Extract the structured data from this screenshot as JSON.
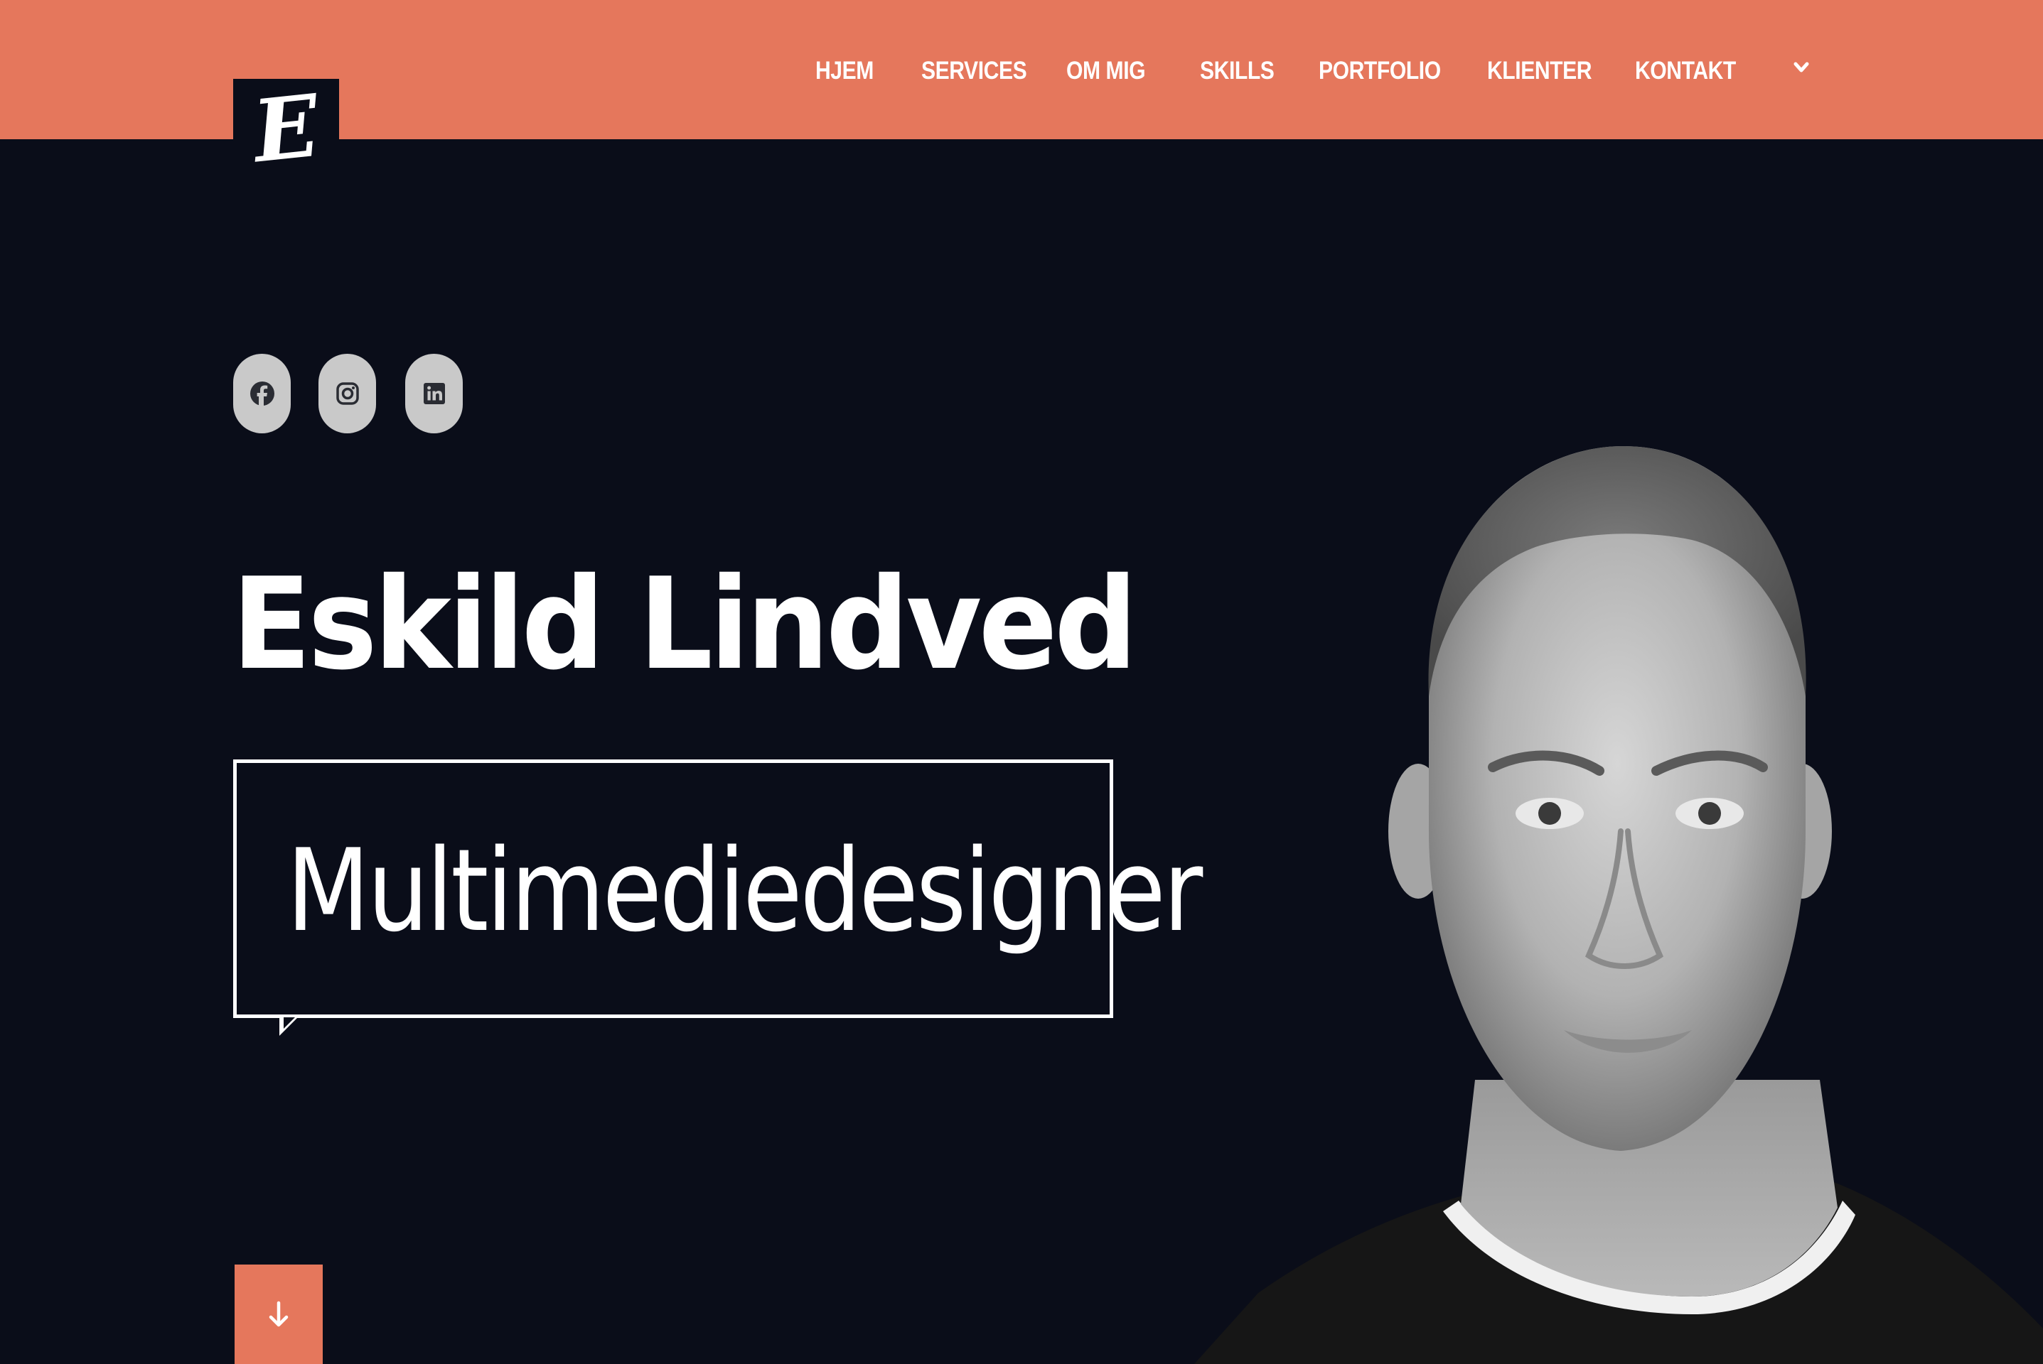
{
  "header": {
    "background_color": "#e5775c",
    "logo_letter": "E",
    "nav": {
      "items": [
        {
          "label": "HJEM"
        },
        {
          "label": "SERVICES"
        },
        {
          "label": "OM MIG"
        },
        {
          "label": "SKILLS"
        },
        {
          "label": "PORTFOLIO"
        },
        {
          "label": "KLIENTER"
        },
        {
          "label": "KONTAKT"
        }
      ],
      "dropdown_icon": "chevron-down-icon"
    }
  },
  "social": {
    "icons": [
      "facebook-icon",
      "instagram-icon",
      "linkedin-icon"
    ],
    "button_color": "#c9c9c9"
  },
  "hero": {
    "name": "Eskild Lindved",
    "title": "Multimediedesigner",
    "scroll_icon": "arrow-down-icon",
    "portrait": "grayscale photo of a man"
  },
  "colors": {
    "background": "#0a0d19",
    "accent": "#e5775c",
    "text": "#ffffff"
  }
}
